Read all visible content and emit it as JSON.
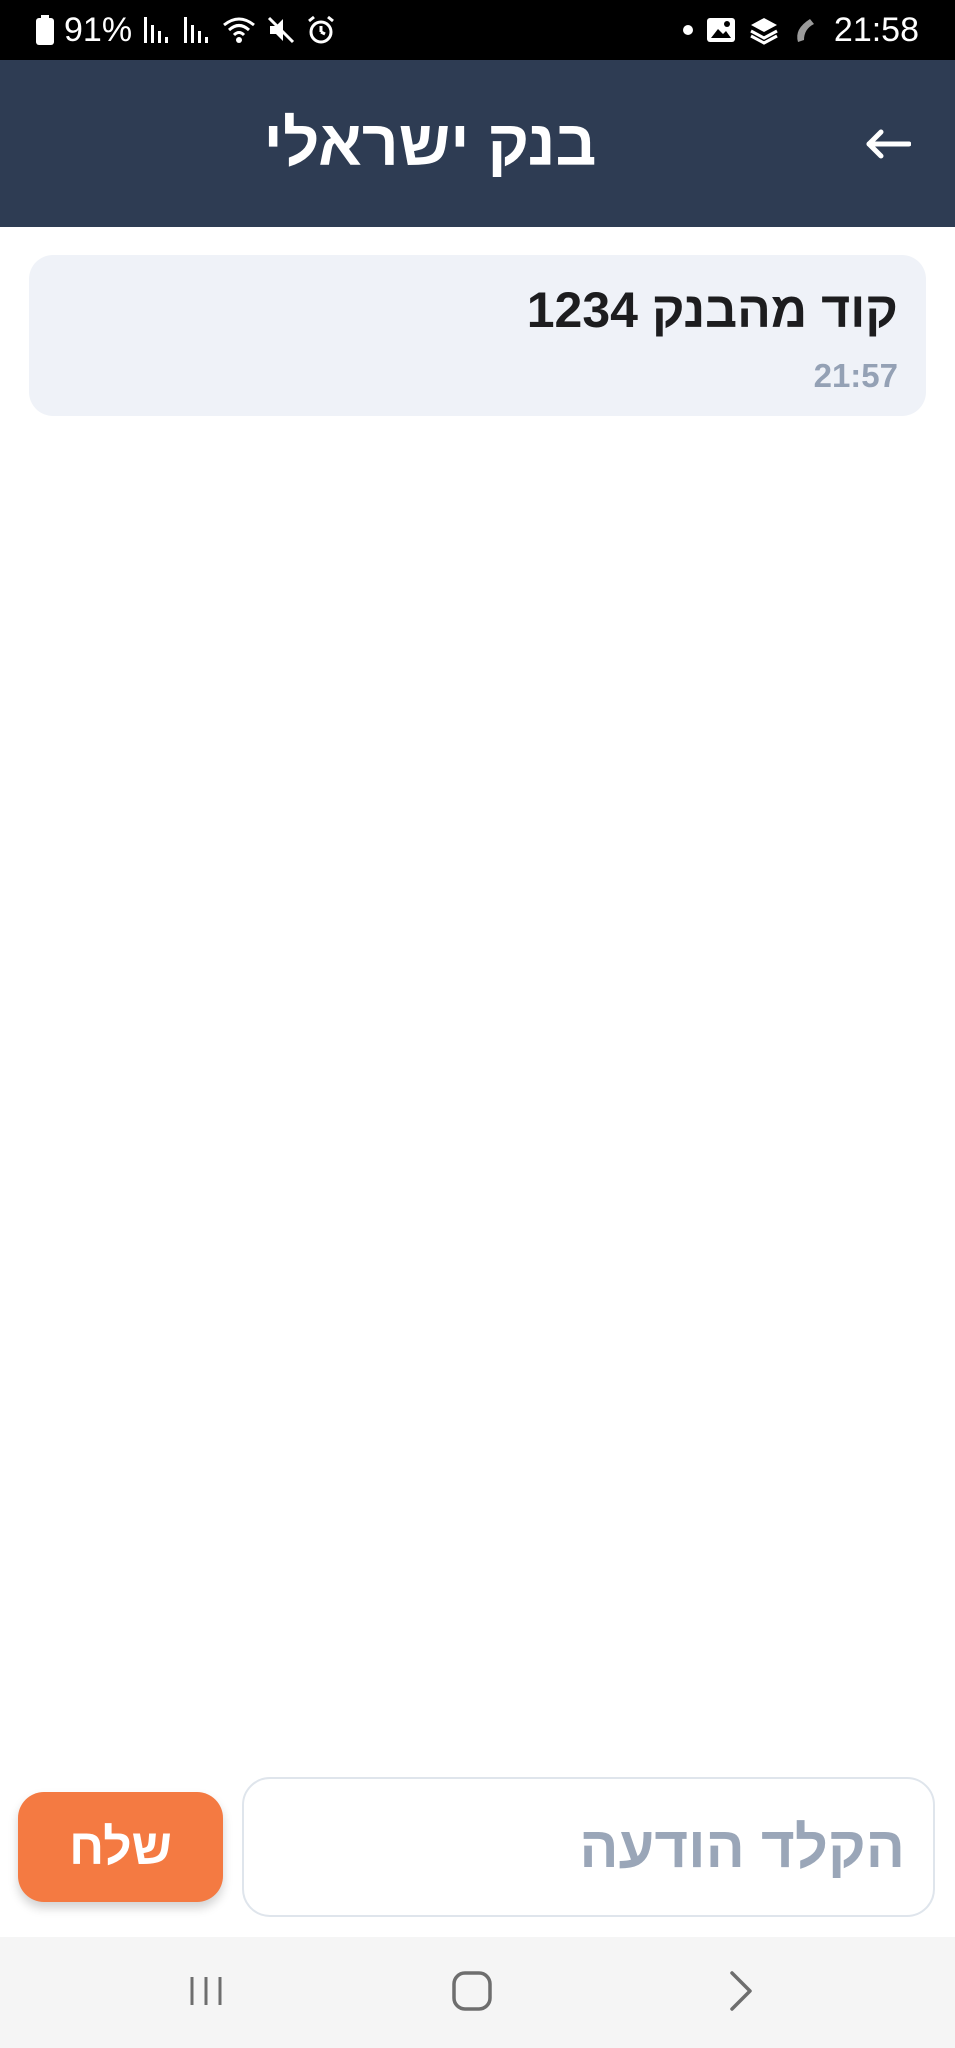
{
  "status_bar": {
    "battery": "91%",
    "time": "21:58"
  },
  "header": {
    "title": "בנק ישראלי",
    "back_icon": "arrow-left-icon"
  },
  "messages": [
    {
      "text": "קוד מהבנק 1234",
      "time": "21:57"
    }
  ],
  "composer": {
    "placeholder": "הקלד הודעה",
    "value": "",
    "send_label": "שלח"
  },
  "nav_bar": {
    "icons": [
      "recents-icon",
      "home-icon",
      "back-icon"
    ]
  },
  "colors": {
    "header_bg": "#2e3c53",
    "bubble_bg": "#eff2f8",
    "send_button": "#f47a42",
    "time_text": "#94a1b5",
    "placeholder": "#9aa6b8"
  }
}
